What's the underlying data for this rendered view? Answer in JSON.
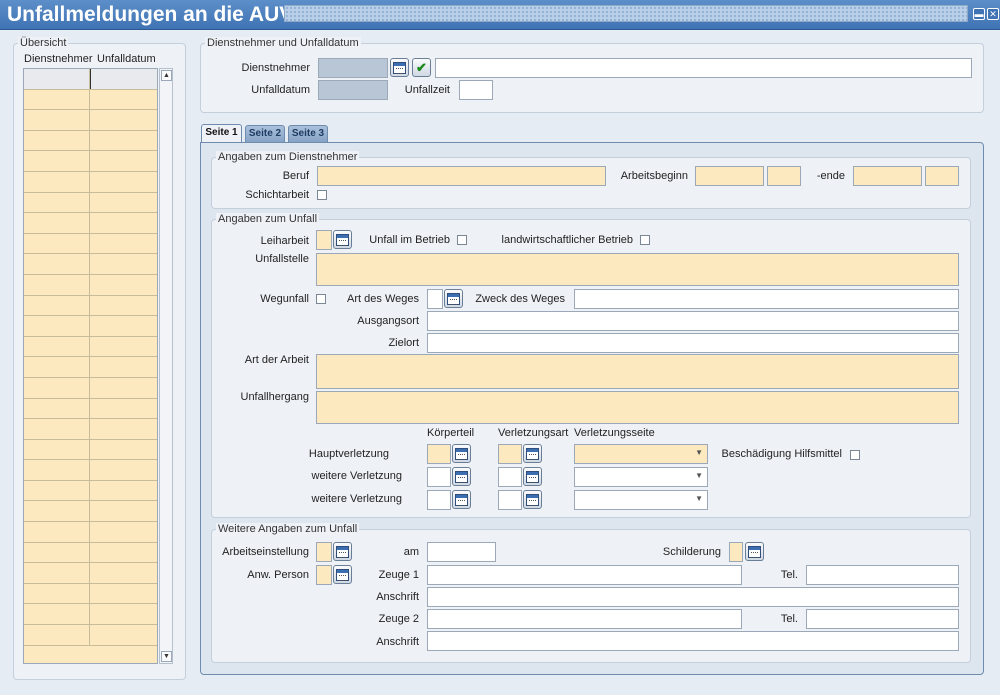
{
  "window": {
    "title": "Unfallmeldungen an die AUVA",
    "minimize_glyph": "▬",
    "close_glyph": "✕"
  },
  "overview": {
    "title": "Übersicht",
    "columns": [
      "Dienstnehmer",
      "Unfalldatum"
    ],
    "rows": 28
  },
  "employee_section": {
    "title": "Dienstnehmer und Unfalldatum",
    "employee_label": "Dienstnehmer",
    "accident_date_label": "Unfalldatum",
    "accident_time_label": "Unfallzeit"
  },
  "tabs": [
    {
      "label": "Seite 1",
      "active": true
    },
    {
      "label": "Seite 2",
      "active": false
    },
    {
      "label": "Seite 3",
      "active": false
    }
  ],
  "employee_info": {
    "title": "Angaben zum Dienstnehmer",
    "profession_label": "Beruf",
    "work_start_label": "Arbeitsbeginn",
    "work_end_label": "-ende",
    "shift_work_label": "Schichtarbeit"
  },
  "accident_info": {
    "title": "Angaben zum Unfall",
    "temp_work_label": "Leiharbeit",
    "in_company_label": "Unfall im Betrieb",
    "agricultural_label": "landwirtschaftlicher Betrieb",
    "location_label": "Unfallstelle",
    "commute_label": "Wegunfall",
    "route_type_label": "Art des Weges",
    "route_purpose_label": "Zweck des Weges",
    "origin_label": "Ausgangsort",
    "destination_label": "Zielort",
    "work_type_label": "Art der Arbeit",
    "course_label": "Unfallhergang",
    "injury_headers": {
      "body_part": "Körperteil",
      "injury_type": "Verletzungsart",
      "injury_side": "Verletzungsseite"
    },
    "main_injury_label": "Hauptverletzung",
    "further_injury_label": "weitere Verletzung",
    "aid_damage_label": "Beschädigung Hilfsmittel"
  },
  "further_info": {
    "title": "Weitere Angaben zum Unfall",
    "work_stop_label": "Arbeitseinstellung",
    "on_label": "am",
    "description_label": "Schilderung",
    "person_present_label": "Anw. Person",
    "witness1_label": "Zeuge 1",
    "witness2_label": "Zeuge 2",
    "phone_label": "Tel.",
    "address_label": "Anschrift"
  },
  "icons": {
    "lov": "calendar-list-icon",
    "confirm": "check-icon",
    "dropdown": "chevron-down-icon"
  }
}
